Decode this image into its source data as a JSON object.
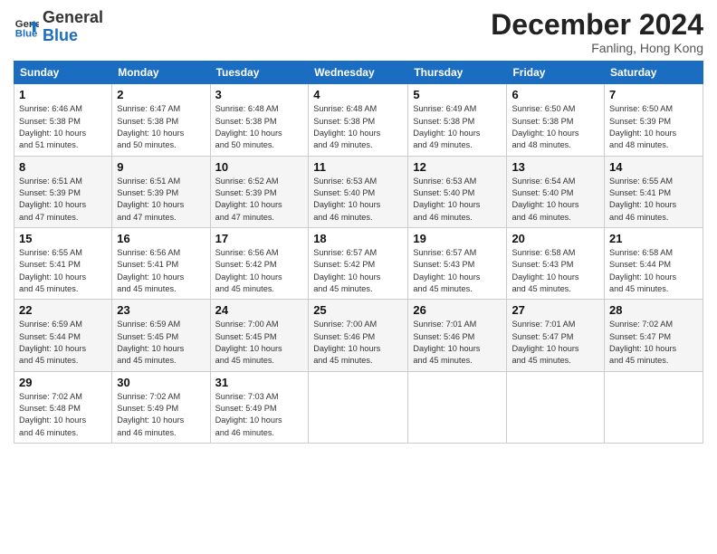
{
  "header": {
    "logo_line1": "General",
    "logo_line2": "Blue",
    "month_title": "December 2024",
    "location": "Fanling, Hong Kong"
  },
  "days_of_week": [
    "Sunday",
    "Monday",
    "Tuesday",
    "Wednesday",
    "Thursday",
    "Friday",
    "Saturday"
  ],
  "weeks": [
    [
      {
        "day": "1",
        "info": "Sunrise: 6:46 AM\nSunset: 5:38 PM\nDaylight: 10 hours\nand 51 minutes."
      },
      {
        "day": "2",
        "info": "Sunrise: 6:47 AM\nSunset: 5:38 PM\nDaylight: 10 hours\nand 50 minutes."
      },
      {
        "day": "3",
        "info": "Sunrise: 6:48 AM\nSunset: 5:38 PM\nDaylight: 10 hours\nand 50 minutes."
      },
      {
        "day": "4",
        "info": "Sunrise: 6:48 AM\nSunset: 5:38 PM\nDaylight: 10 hours\nand 49 minutes."
      },
      {
        "day": "5",
        "info": "Sunrise: 6:49 AM\nSunset: 5:38 PM\nDaylight: 10 hours\nand 49 minutes."
      },
      {
        "day": "6",
        "info": "Sunrise: 6:50 AM\nSunset: 5:38 PM\nDaylight: 10 hours\nand 48 minutes."
      },
      {
        "day": "7",
        "info": "Sunrise: 6:50 AM\nSunset: 5:39 PM\nDaylight: 10 hours\nand 48 minutes."
      }
    ],
    [
      {
        "day": "8",
        "info": "Sunrise: 6:51 AM\nSunset: 5:39 PM\nDaylight: 10 hours\nand 47 minutes."
      },
      {
        "day": "9",
        "info": "Sunrise: 6:51 AM\nSunset: 5:39 PM\nDaylight: 10 hours\nand 47 minutes."
      },
      {
        "day": "10",
        "info": "Sunrise: 6:52 AM\nSunset: 5:39 PM\nDaylight: 10 hours\nand 47 minutes."
      },
      {
        "day": "11",
        "info": "Sunrise: 6:53 AM\nSunset: 5:40 PM\nDaylight: 10 hours\nand 46 minutes."
      },
      {
        "day": "12",
        "info": "Sunrise: 6:53 AM\nSunset: 5:40 PM\nDaylight: 10 hours\nand 46 minutes."
      },
      {
        "day": "13",
        "info": "Sunrise: 6:54 AM\nSunset: 5:40 PM\nDaylight: 10 hours\nand 46 minutes."
      },
      {
        "day": "14",
        "info": "Sunrise: 6:55 AM\nSunset: 5:41 PM\nDaylight: 10 hours\nand 46 minutes."
      }
    ],
    [
      {
        "day": "15",
        "info": "Sunrise: 6:55 AM\nSunset: 5:41 PM\nDaylight: 10 hours\nand 45 minutes."
      },
      {
        "day": "16",
        "info": "Sunrise: 6:56 AM\nSunset: 5:41 PM\nDaylight: 10 hours\nand 45 minutes."
      },
      {
        "day": "17",
        "info": "Sunrise: 6:56 AM\nSunset: 5:42 PM\nDaylight: 10 hours\nand 45 minutes."
      },
      {
        "day": "18",
        "info": "Sunrise: 6:57 AM\nSunset: 5:42 PM\nDaylight: 10 hours\nand 45 minutes."
      },
      {
        "day": "19",
        "info": "Sunrise: 6:57 AM\nSunset: 5:43 PM\nDaylight: 10 hours\nand 45 minutes."
      },
      {
        "day": "20",
        "info": "Sunrise: 6:58 AM\nSunset: 5:43 PM\nDaylight: 10 hours\nand 45 minutes."
      },
      {
        "day": "21",
        "info": "Sunrise: 6:58 AM\nSunset: 5:44 PM\nDaylight: 10 hours\nand 45 minutes."
      }
    ],
    [
      {
        "day": "22",
        "info": "Sunrise: 6:59 AM\nSunset: 5:44 PM\nDaylight: 10 hours\nand 45 minutes."
      },
      {
        "day": "23",
        "info": "Sunrise: 6:59 AM\nSunset: 5:45 PM\nDaylight: 10 hours\nand 45 minutes."
      },
      {
        "day": "24",
        "info": "Sunrise: 7:00 AM\nSunset: 5:45 PM\nDaylight: 10 hours\nand 45 minutes."
      },
      {
        "day": "25",
        "info": "Sunrise: 7:00 AM\nSunset: 5:46 PM\nDaylight: 10 hours\nand 45 minutes."
      },
      {
        "day": "26",
        "info": "Sunrise: 7:01 AM\nSunset: 5:46 PM\nDaylight: 10 hours\nand 45 minutes."
      },
      {
        "day": "27",
        "info": "Sunrise: 7:01 AM\nSunset: 5:47 PM\nDaylight: 10 hours\nand 45 minutes."
      },
      {
        "day": "28",
        "info": "Sunrise: 7:02 AM\nSunset: 5:47 PM\nDaylight: 10 hours\nand 45 minutes."
      }
    ],
    [
      {
        "day": "29",
        "info": "Sunrise: 7:02 AM\nSunset: 5:48 PM\nDaylight: 10 hours\nand 46 minutes."
      },
      {
        "day": "30",
        "info": "Sunrise: 7:02 AM\nSunset: 5:49 PM\nDaylight: 10 hours\nand 46 minutes."
      },
      {
        "day": "31",
        "info": "Sunrise: 7:03 AM\nSunset: 5:49 PM\nDaylight: 10 hours\nand 46 minutes."
      },
      {
        "day": "",
        "info": ""
      },
      {
        "day": "",
        "info": ""
      },
      {
        "day": "",
        "info": ""
      },
      {
        "day": "",
        "info": ""
      }
    ]
  ]
}
